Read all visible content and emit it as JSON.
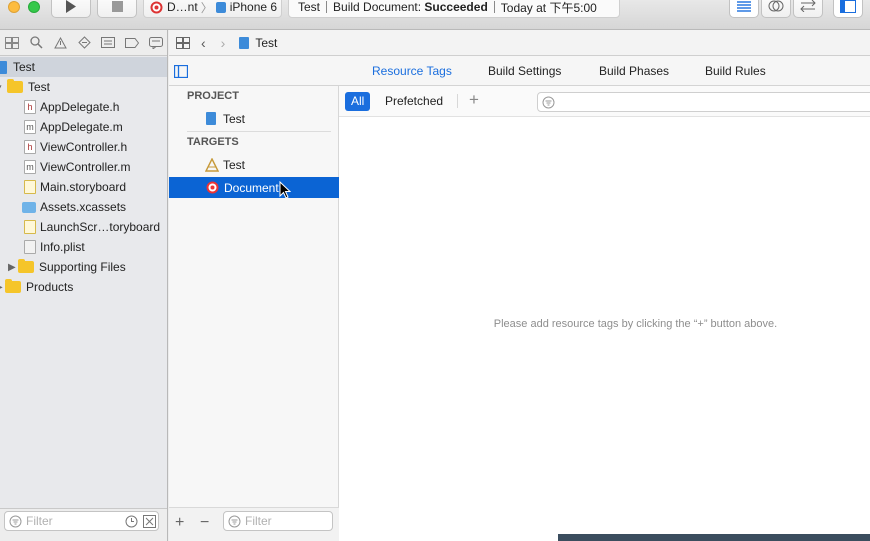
{
  "toolbar": {
    "run_icon": "play-icon",
    "stop_icon": "stop-icon",
    "scheme": {
      "target": "D…nt",
      "device": "iPhone 6"
    },
    "activity": {
      "project": "Test",
      "status_prefix": "Build Document:",
      "status_result": "Succeeded",
      "time": "Today at 下午5:00"
    },
    "editor_icons": [
      "standard-editor-icon",
      "assistant-editor-icon",
      "version-editor-icon",
      "navigator-toggle-icon"
    ]
  },
  "navigator": {
    "tab_icons": [
      "folder-icon",
      "search-icon",
      "warning-icon",
      "test-icon",
      "debug-icon",
      "breakpoint-icon",
      "report-icon"
    ],
    "root_label": "Test",
    "items": [
      {
        "label": "Test",
        "kind": "folder"
      },
      {
        "label": "AppDelegate.h",
        "kind": "header"
      },
      {
        "label": "AppDelegate.m",
        "kind": "source"
      },
      {
        "label": "ViewController.h",
        "kind": "header"
      },
      {
        "label": "ViewController.m",
        "kind": "source"
      },
      {
        "label": "Main.storyboard",
        "kind": "storyboard"
      },
      {
        "label": "Assets.xcassets",
        "kind": "assets"
      },
      {
        "label": "LaunchScr…toryboard",
        "kind": "storyboard"
      },
      {
        "label": "Info.plist",
        "kind": "plist"
      },
      {
        "label": "Supporting Files",
        "kind": "folder"
      },
      {
        "label": "Products",
        "kind": "folder"
      }
    ],
    "filter_placeholder": "Filter"
  },
  "jumpbar": {
    "crumb": "Test"
  },
  "editor_tabs": [
    "Resource Tags",
    "Build Settings",
    "Build Phases",
    "Build Rules"
  ],
  "active_tab": "Resource Tags",
  "project_list": {
    "project_header": "PROJECT",
    "project_item": "Test",
    "targets_header": "TARGETS",
    "targets": [
      "Test",
      "Document"
    ],
    "selected_target": "Document",
    "filter_placeholder": "Filter"
  },
  "resource_tags": {
    "filters": [
      "All",
      "Prefetched"
    ],
    "active_filter": "All",
    "empty_message": "Please add resource tags by clicking the “+” button above."
  },
  "colors": {
    "accent": "#1a6ede",
    "selection": "#0b64d4",
    "tab_active": "#1a6ede"
  }
}
